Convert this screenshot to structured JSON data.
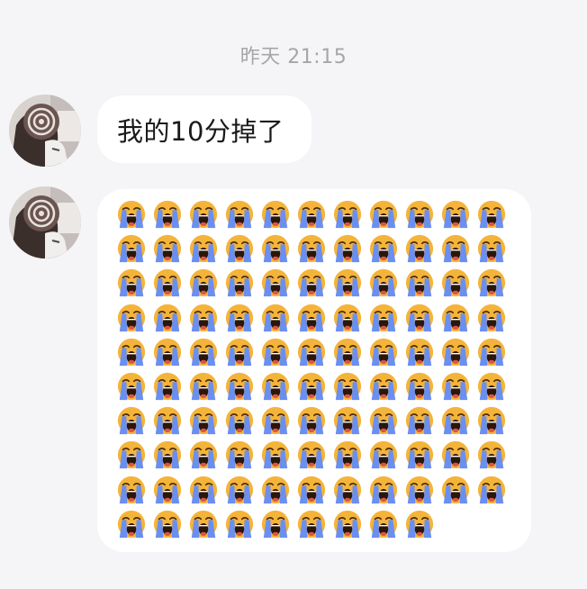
{
  "chat": {
    "timestamp": "昨天 21:15",
    "messages": [
      {
        "type": "text",
        "text": "我的10分掉了",
        "avatar_icon": "user-avatar-icon"
      },
      {
        "type": "emoji-grid",
        "emoji_icon": "loudly-crying-face-icon",
        "emoji": "😭",
        "rows": 10,
        "columns": 11,
        "last_row_count": 9,
        "avatar_icon": "user-avatar-icon"
      }
    ]
  },
  "colors": {
    "background": "#f5f5f7",
    "bubble": "#ffffff",
    "timestamp_text": "#a6a6a9",
    "message_text": "#1a1a1a",
    "emoji_face": "#f4b43a",
    "emoji_tears": "#6a8ff0"
  }
}
